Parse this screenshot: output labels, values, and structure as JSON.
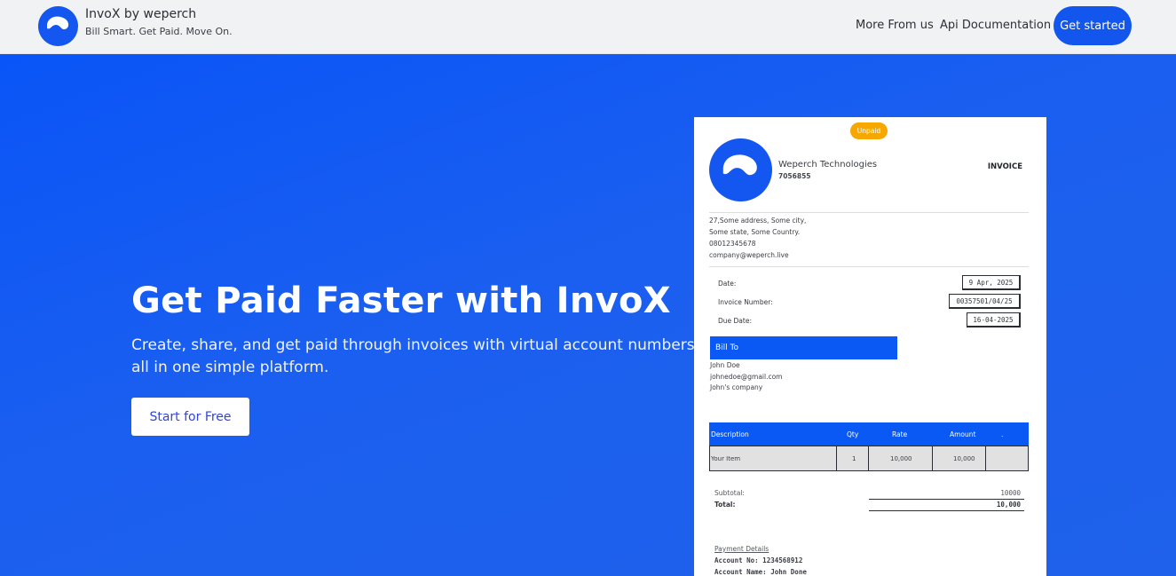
{
  "header": {
    "brand_name": "InvoX by weperch",
    "brand_tagline": "Bill Smart. Get Paid. Move On.",
    "nav": {
      "more": "More From us",
      "api": "Api Documentation",
      "cta": "Get started"
    }
  },
  "hero": {
    "title": "Get Paid Faster with InvoX",
    "subtitle": "Create, share, and get paid through invoices with virtual account numbers — all in one simple platform.",
    "cta": "Start for Free"
  },
  "invoice": {
    "status": "Unpaid",
    "company": "Weperch Technologies",
    "company_phone": "7056855",
    "title": "INVOICE",
    "address": [
      "27,Some address, Some city,",
      "Some state, Some Country.",
      "08012345678",
      "company@weperch.live"
    ],
    "meta": {
      "date_label": "Date:",
      "date_value": "9 Apr, 2025",
      "number_label": "Invoice Number:",
      "number_value": "00357501/04/25",
      "due_label": "Due Date:",
      "due_value": "16-04-2025"
    },
    "bill_to": {
      "heading": "Bill To",
      "name": "John Doe",
      "email": "johnedoe@gmail.com",
      "company": "John's company"
    },
    "table": {
      "headers": [
        "Description",
        "Qty",
        "Rate",
        "Amount",
        "."
      ],
      "rows": [
        [
          "Your Item",
          "1",
          "10,000",
          "10,000"
        ]
      ]
    },
    "totals": {
      "subtotal_label": "Subtotal:",
      "subtotal_value": "10000",
      "total_label": "Total:",
      "total_value": "10,000"
    },
    "payment": {
      "heading": "Payment Details",
      "account_no": "Account No: 1234568912",
      "account_name": "Account Name: John Done"
    }
  },
  "colors": {
    "primary": "#1357f0",
    "hero_bg": "#1a5cf0",
    "status": "#f6a800"
  }
}
